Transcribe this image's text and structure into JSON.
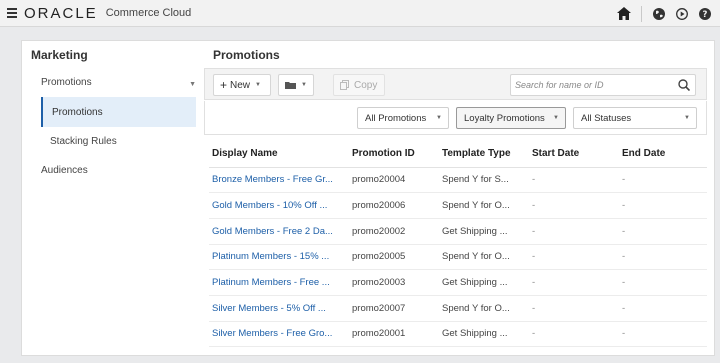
{
  "header": {
    "logo": "ORACLE",
    "product": "Commerce Cloud",
    "icons": [
      "hamburger-icon",
      "home-icon",
      "globe-icon",
      "play-icon",
      "help-icon"
    ]
  },
  "sidebar": {
    "title": "Marketing",
    "items": [
      {
        "label": "Promotions",
        "expanded": true
      },
      {
        "label": "Promotions",
        "selected": true
      },
      {
        "label": "Stacking Rules"
      },
      {
        "label": "Audiences"
      }
    ]
  },
  "content": {
    "title": "Promotions",
    "toolbar": {
      "new_label": "New",
      "new_icon": "plus-icon",
      "folder_icon": "folder-icon",
      "copy_label": "Copy",
      "copy_icon": "copy-icon",
      "search_placeholder": "Search for name or ID"
    },
    "filters": {
      "type": "All Promotions",
      "folder": "Loyalty Promotions",
      "status": "All Statuses"
    },
    "columns": [
      "Display Name",
      "Promotion ID",
      "Template Type",
      "Start Date",
      "End Date"
    ],
    "rows": [
      {
        "name": "Bronze Members - Free Gr...",
        "id": "promo20004",
        "template": "Spend Y for S...",
        "start": "-",
        "end": "-"
      },
      {
        "name": "Gold Members - 10% Off ...",
        "id": "promo20006",
        "template": "Spend Y for O...",
        "start": "-",
        "end": "-"
      },
      {
        "name": "Gold Members - Free 2 Da...",
        "id": "promo20002",
        "template": "Get Shipping ...",
        "start": "-",
        "end": "-"
      },
      {
        "name": "Platinum Members - 15% ...",
        "id": "promo20005",
        "template": "Spend Y for O...",
        "start": "-",
        "end": "-"
      },
      {
        "name": "Platinum Members - Free ...",
        "id": "promo20003",
        "template": "Get Shipping ...",
        "start": "-",
        "end": "-"
      },
      {
        "name": "Silver Members - 5% Off ...",
        "id": "promo20007",
        "template": "Spend Y for O...",
        "start": "-",
        "end": "-"
      },
      {
        "name": "Silver Members - Free Gro...",
        "id": "promo20001",
        "template": "Get Shipping ...",
        "start": "-",
        "end": "-"
      }
    ]
  },
  "colors": {
    "link": "#1d5fa8",
    "selected_bg": "#e3eef9",
    "accent": "#1d5fa8"
  }
}
